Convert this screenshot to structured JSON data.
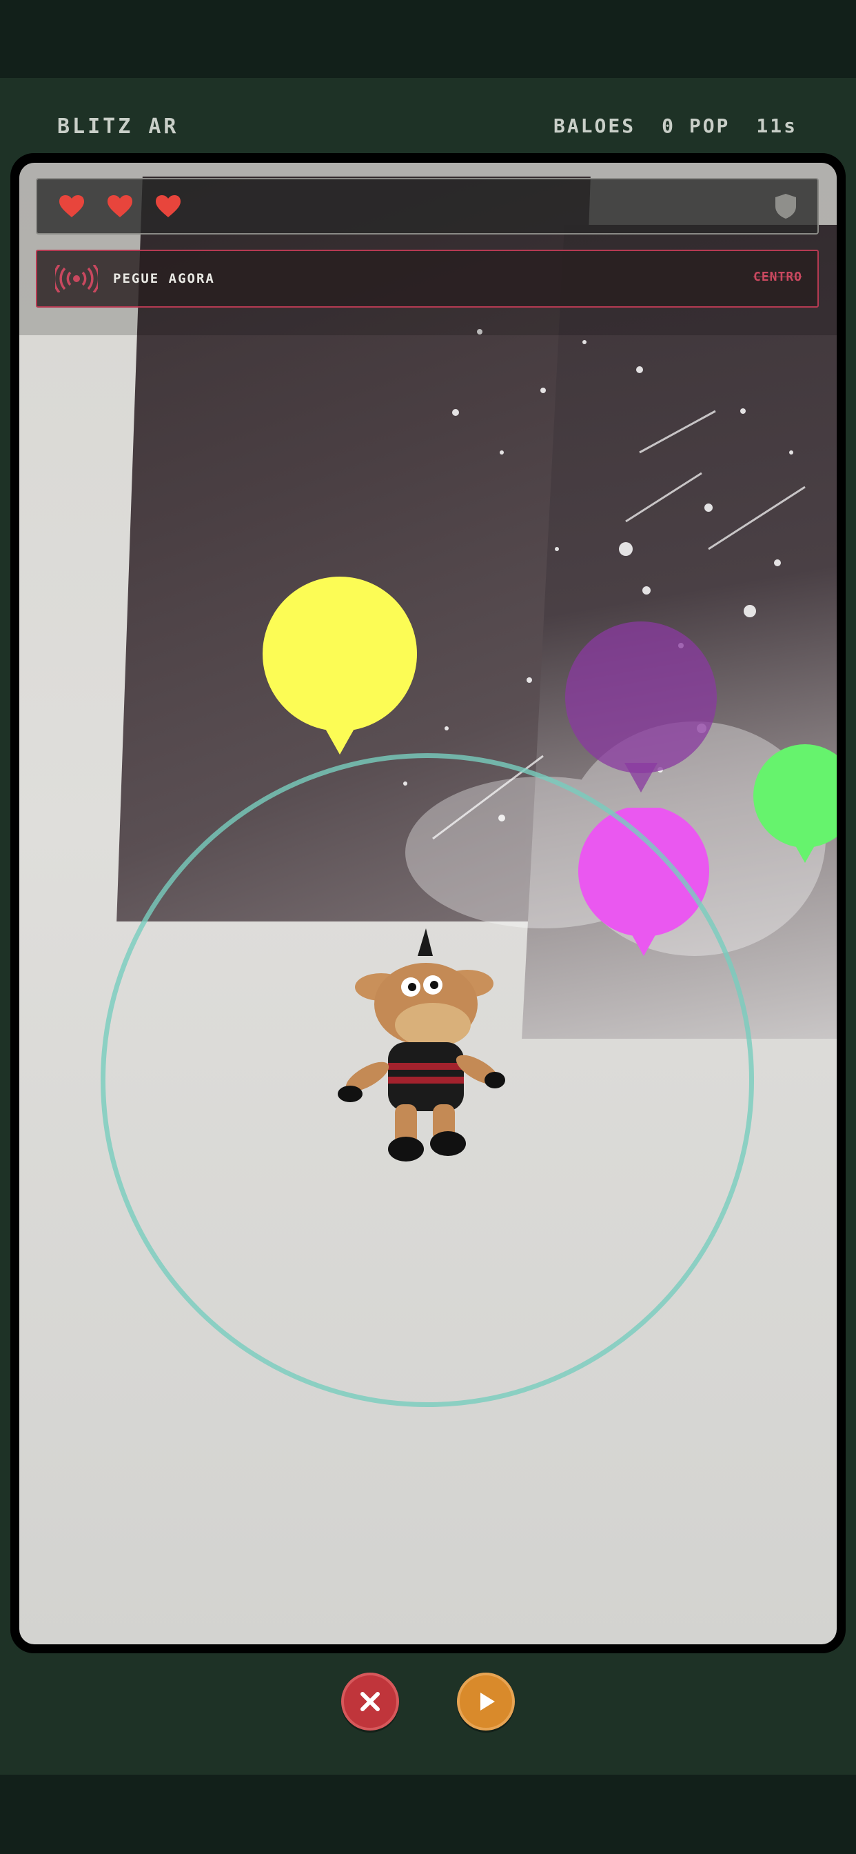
{
  "header": {
    "title": "BLITZ AR",
    "balloons_label": "BALOES",
    "pop_count": "0 POP",
    "timer": "11s"
  },
  "hud": {
    "lives": 3,
    "signal_label": "PEGUE AGORA",
    "signal_status": "CENTRO"
  },
  "balloons": [
    {
      "color": "#fcfc55",
      "state": "active"
    },
    {
      "color": "#8a3aa0",
      "state": "faded"
    },
    {
      "color": "#66f36d",
      "state": "active"
    },
    {
      "color": "#ea58f0",
      "state": "active"
    }
  ],
  "colors": {
    "background": "#1e3226",
    "heart": "#e8453c",
    "signal_accent": "#c9485f",
    "ring": "#78cdbe",
    "close_button": "#c0353b",
    "play_button": "#d98a2b"
  },
  "icons": {
    "heart": "heart-icon",
    "shield": "shield-icon",
    "signal": "broadcast-icon",
    "close": "close-icon",
    "play": "play-icon"
  }
}
